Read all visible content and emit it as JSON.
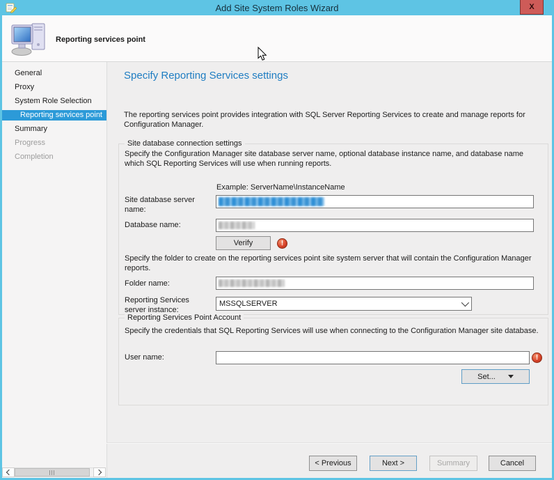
{
  "window": {
    "title": "Add Site System Roles Wizard",
    "close_glyph": "X"
  },
  "header": {
    "role_title": "Reporting services point"
  },
  "sidebar": {
    "items": [
      {
        "label": "General",
        "state": "normal"
      },
      {
        "label": "Proxy",
        "state": "normal"
      },
      {
        "label": "System Role Selection",
        "state": "normal"
      },
      {
        "label": "Reporting services point",
        "state": "selected"
      },
      {
        "label": "Summary",
        "state": "normal"
      },
      {
        "label": "Progress",
        "state": "disabled"
      },
      {
        "label": "Completion",
        "state": "disabled"
      }
    ]
  },
  "content": {
    "heading": "Specify Reporting Services settings",
    "intro": "The reporting services point provides integration with SQL Server Reporting Services to create and manage reports for Configuration Manager.",
    "db_group": {
      "legend": "Site database connection settings",
      "description": "Specify the Configuration Manager site database server name, optional database instance name, and database name which SQL Reporting Services will use when running reports.",
      "example": "Example: ServerName\\InstanceName",
      "server_label": "Site database server name:",
      "server_value_redacted": true,
      "database_label": "Database name:",
      "database_value_redacted": true,
      "verify_label": "Verify",
      "folder_note": "Specify the folder to create on the reporting services point site system server that will contain the Configuration Manager reports.",
      "folder_label": "Folder name:",
      "folder_value_redacted": true,
      "instance_label": "Reporting Services server instance:",
      "instance_value": "MSSQLSERVER"
    },
    "account_group": {
      "legend": "Reporting Services Point Account",
      "description": "Specify the credentials that SQL Reporting Services will use when connecting to the Configuration Manager site database.",
      "username_label": "User name:",
      "username_value": "",
      "set_label": "Set..."
    }
  },
  "footer": {
    "previous_label": "< Previous",
    "next_label": "Next >",
    "summary_label": "Summary",
    "cancel_label": "Cancel"
  },
  "icons": {
    "error_glyph": "!"
  },
  "colors": {
    "titlebar_bg": "#5ec4e4",
    "window_border": "#5ec4e4",
    "close_bg": "#ce5b58",
    "selected_nav_bg": "#2c9ad8",
    "heading_text": "#1f7dc2",
    "error_icon": "#d9442b",
    "content_bg": "#efeeee",
    "sidebar_bg": "#f5f4f4",
    "header_bg": "#fbfafa"
  }
}
